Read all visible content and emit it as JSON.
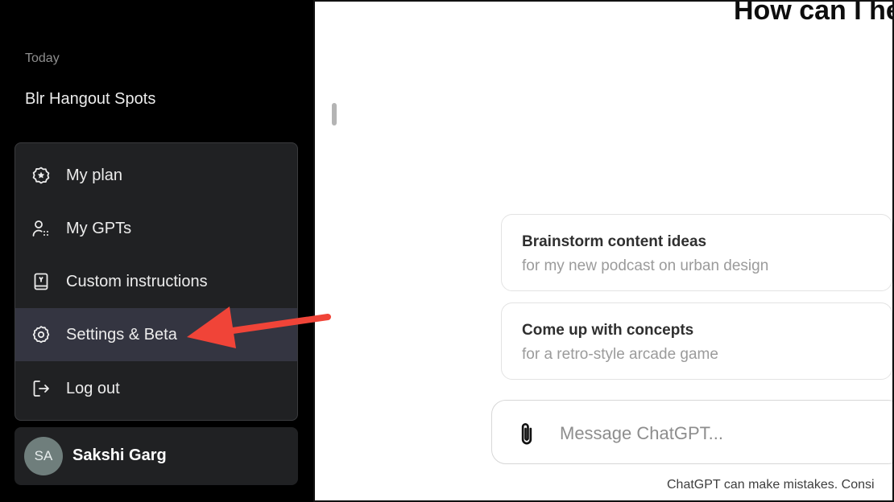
{
  "sidebar": {
    "section_label": "Today",
    "history": [
      {
        "title": "Blr Hangout Spots"
      }
    ],
    "menu": [
      {
        "label": "My plan",
        "icon": "plan-star-icon"
      },
      {
        "label": "My GPTs",
        "icon": "gpts-user-grid-icon"
      },
      {
        "label": "Custom instructions",
        "icon": "instructions-book-icon"
      },
      {
        "label": "Settings & Beta",
        "icon": "gear-icon",
        "highlighted": true
      },
      {
        "label": "Log out",
        "icon": "logout-icon"
      }
    ],
    "user": {
      "initials": "SA",
      "name": "Sakshi Garg"
    }
  },
  "main": {
    "headline": "How can I he",
    "suggestions": [
      {
        "title": "Brainstorm content ideas",
        "subtitle": "for my new podcast on urban design"
      },
      {
        "title": "Come up with concepts",
        "subtitle": "for a retro-style arcade game"
      }
    ],
    "composer": {
      "placeholder": "Message ChatGPT..."
    },
    "disclaimer": "ChatGPT can make mistakes. Consi"
  },
  "annotation": {
    "type": "arrow",
    "color": "#f04438",
    "points_to": "Settings & Beta"
  },
  "colors": {
    "sidebar_bg": "#000000",
    "menu_bg": "#202123",
    "highlight_bg": "#343541",
    "avatar_bg": "#6f7e7c"
  }
}
